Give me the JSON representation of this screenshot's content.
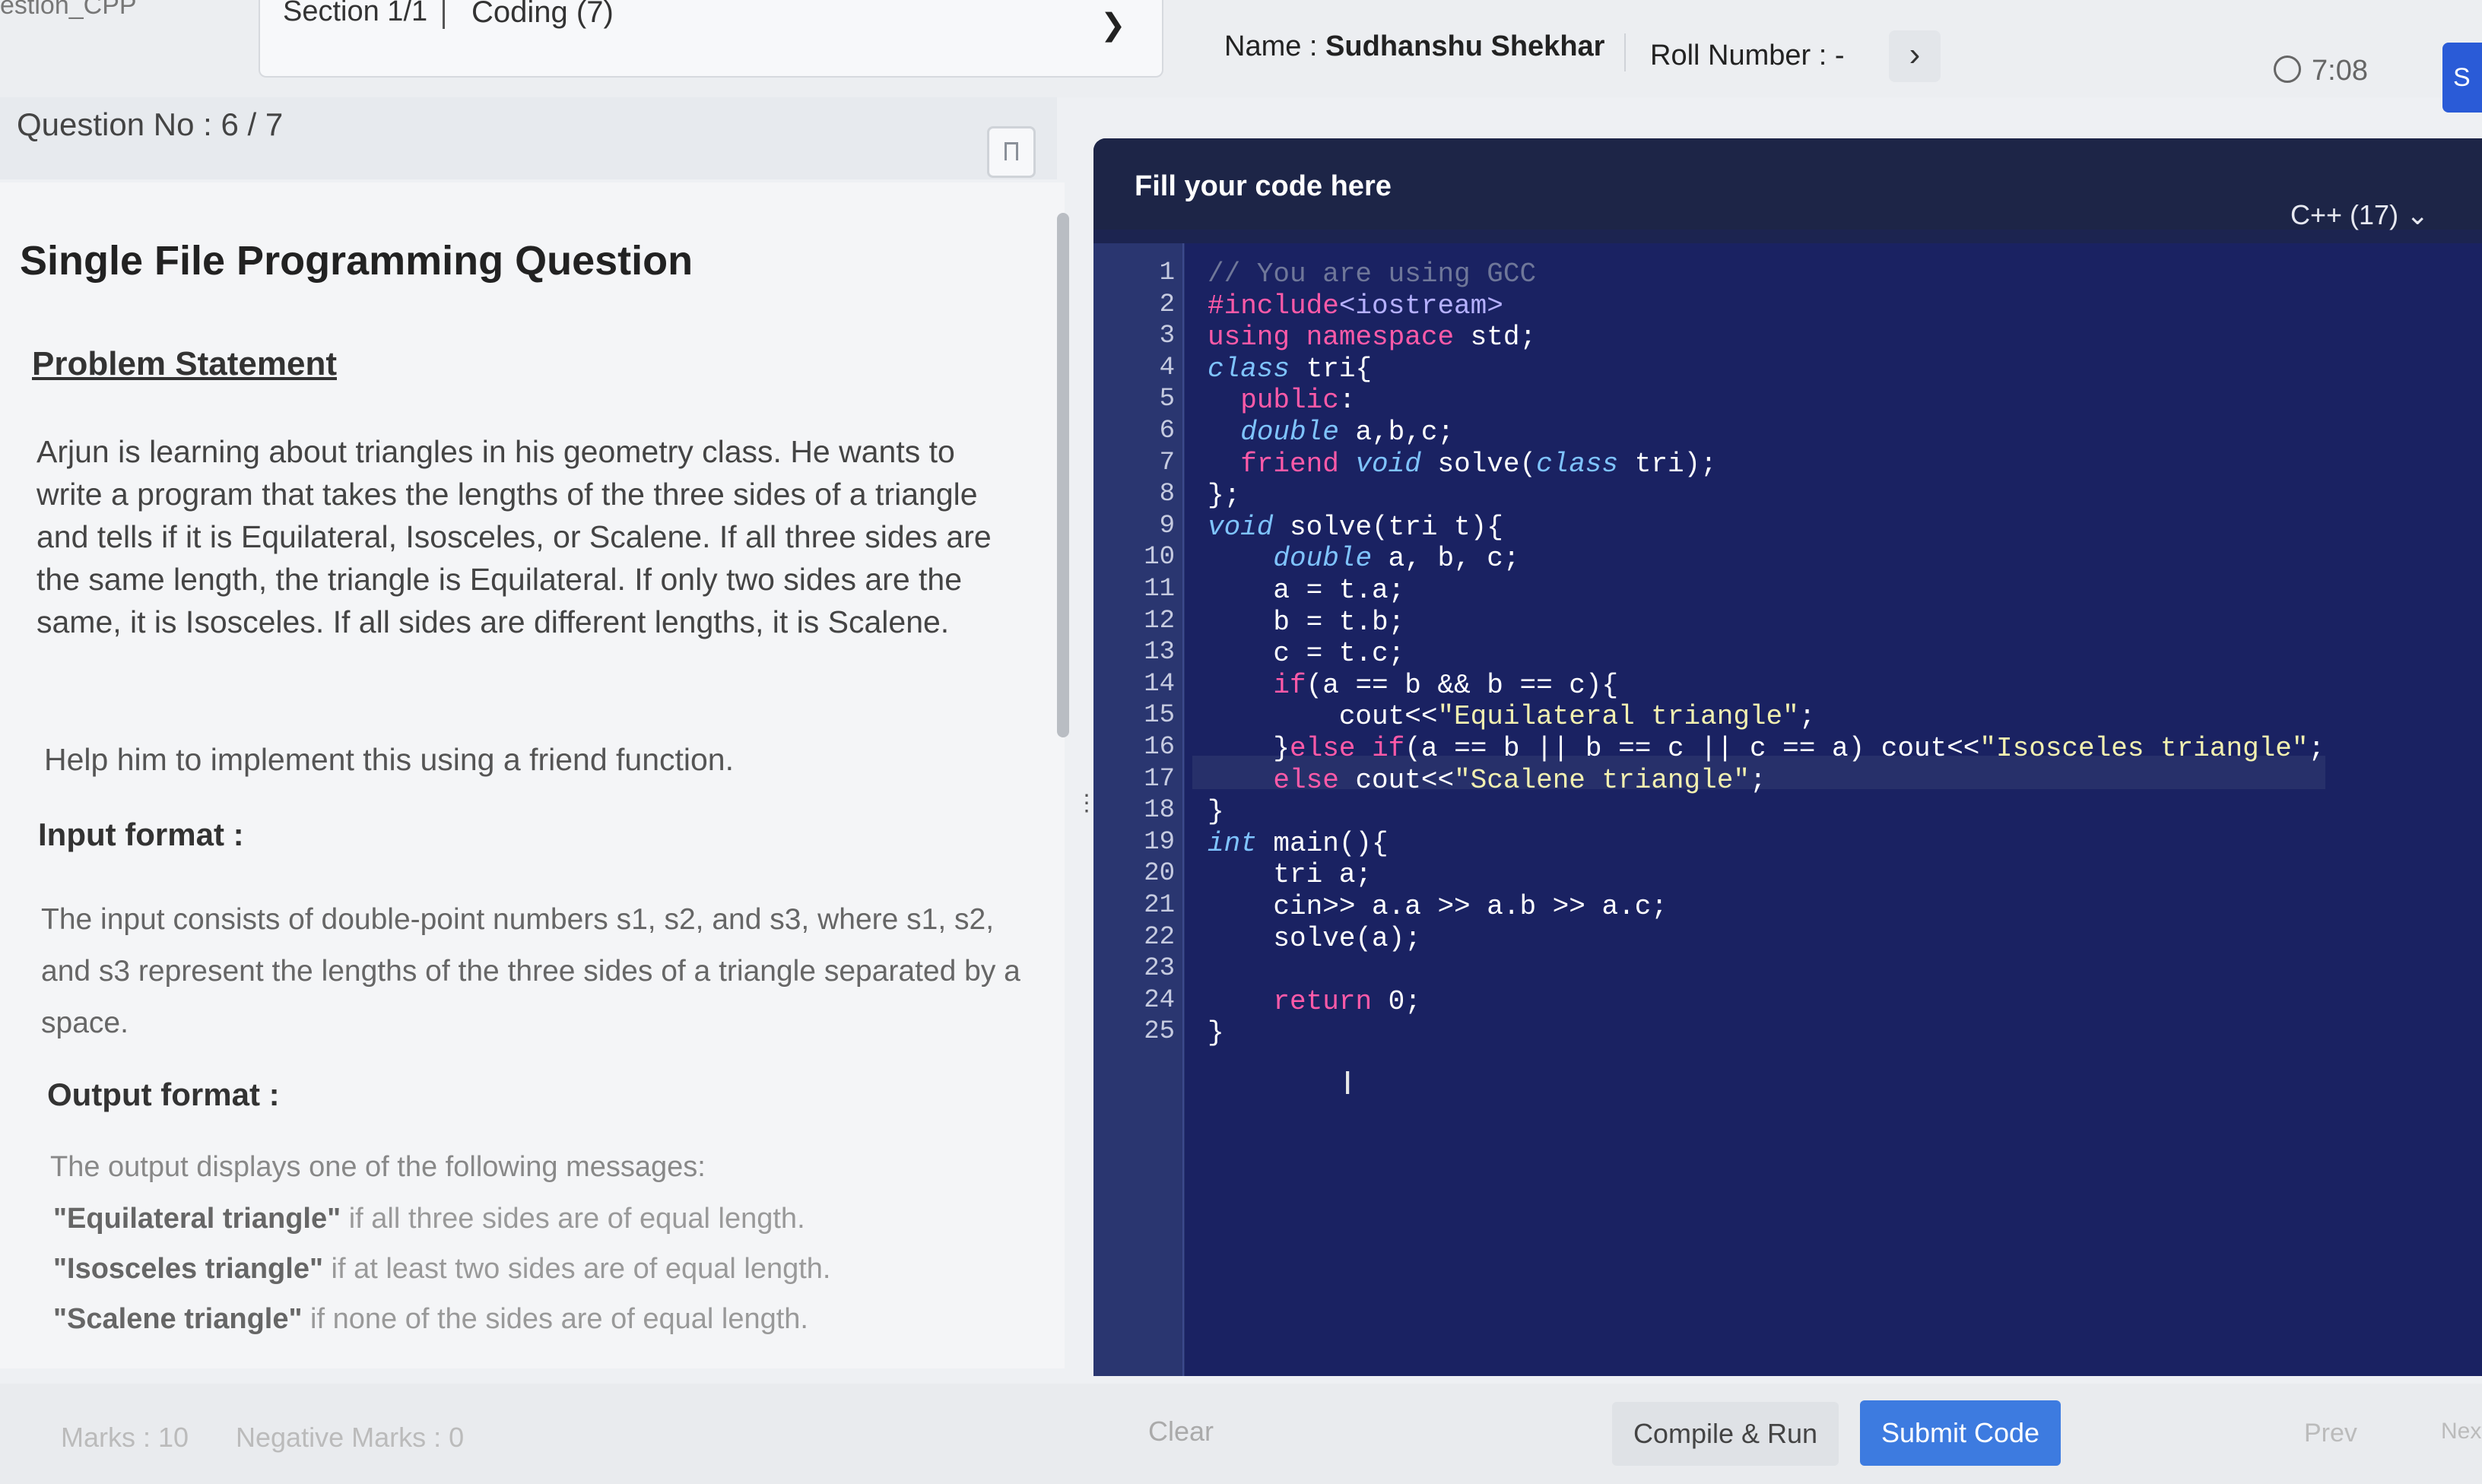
{
  "top": {
    "section_label": "estion_CPP",
    "section": "Section 1/1",
    "category": "Coding (7)",
    "name_label": "Name :",
    "name_value": "Sudhanshu Shekhar",
    "roll_label": "Roll Number : -",
    "timer": "7:08",
    "corner": "S"
  },
  "question": {
    "number": "Question No : 6 / 7",
    "title": "Single File Programming Question",
    "problem_heading": "Problem Statement",
    "statement": "Arjun is learning about triangles in his geometry class. He wants to write a program that takes the lengths of the three sides of a triangle and tells if it is Equilateral, Isosceles, or Scalene. If all three sides are the same length, the triangle is Equilateral. If only two sides are the same, it is Isosceles. If all sides are different lengths, it is Scalene.",
    "help": "Help him to implement this using a friend function.",
    "input_heading": "Input format :",
    "input_text": "The input consists of double-point numbers s1, s2, and s3, where s1, s2, and s3 represent the lengths of the three sides of a triangle separated by a space.",
    "output_heading": "Output format :",
    "output_intro": "The output displays one of the following messages:",
    "out1_bold": "\"Equilateral triangle\"",
    "out1_rest": " if all three sides are of equal length.",
    "out2_bold": "\"Isosceles triangle\"",
    "out2_rest": " if at least two sides are of equal length.",
    "out3_bold": "\"Scalene triangle\"",
    "out3_rest": " if none of the sides are of equal length."
  },
  "editor": {
    "header": "Fill your code here",
    "language": "C++ (17)",
    "lines": [
      "// You are using GCC",
      "#include<iostream>",
      "using namespace std;",
      "class tri{",
      "  public:",
      "  double a,b,c;",
      "  friend void solve(class tri);",
      "};",
      "void solve(tri t){",
      "    double a, b, c;",
      "    a = t.a;",
      "    b = t.b;",
      "    c = t.c;",
      "    if(a == b && b == c){",
      "        cout<<\"Equilateral triangle\";",
      "    }else if(a == b || b == c || c == a) cout<<\"Isosceles triangle\";",
      "    else cout<<\"Scalene triangle\";",
      "}",
      "int main(){",
      "    tri a;",
      "    cin>> a.a >> a.b >> a.c;",
      "    solve(a);",
      "",
      "    return 0;",
      "}"
    ],
    "line_numbers": [
      "1",
      "2",
      "3",
      "4",
      "5",
      "6",
      "7",
      "8",
      "9",
      "10",
      "11",
      "12",
      "13",
      "14",
      "15",
      "16",
      "17",
      "18",
      "19",
      "20",
      "21",
      "22",
      "23",
      "24",
      "25"
    ]
  },
  "footer": {
    "marks": "Marks : 10",
    "negative_marks": "Negative Marks : 0",
    "clear": "Clear",
    "compile": "Compile & Run",
    "submit": "Submit Code",
    "prev": "Prev",
    "next": "Next"
  },
  "colors": {
    "editor_bg": "#1a2262",
    "submit": "#3d7be0",
    "keyword": "#ff5aa8",
    "type": "#7fc4ff",
    "string": "#f2f0b0"
  }
}
